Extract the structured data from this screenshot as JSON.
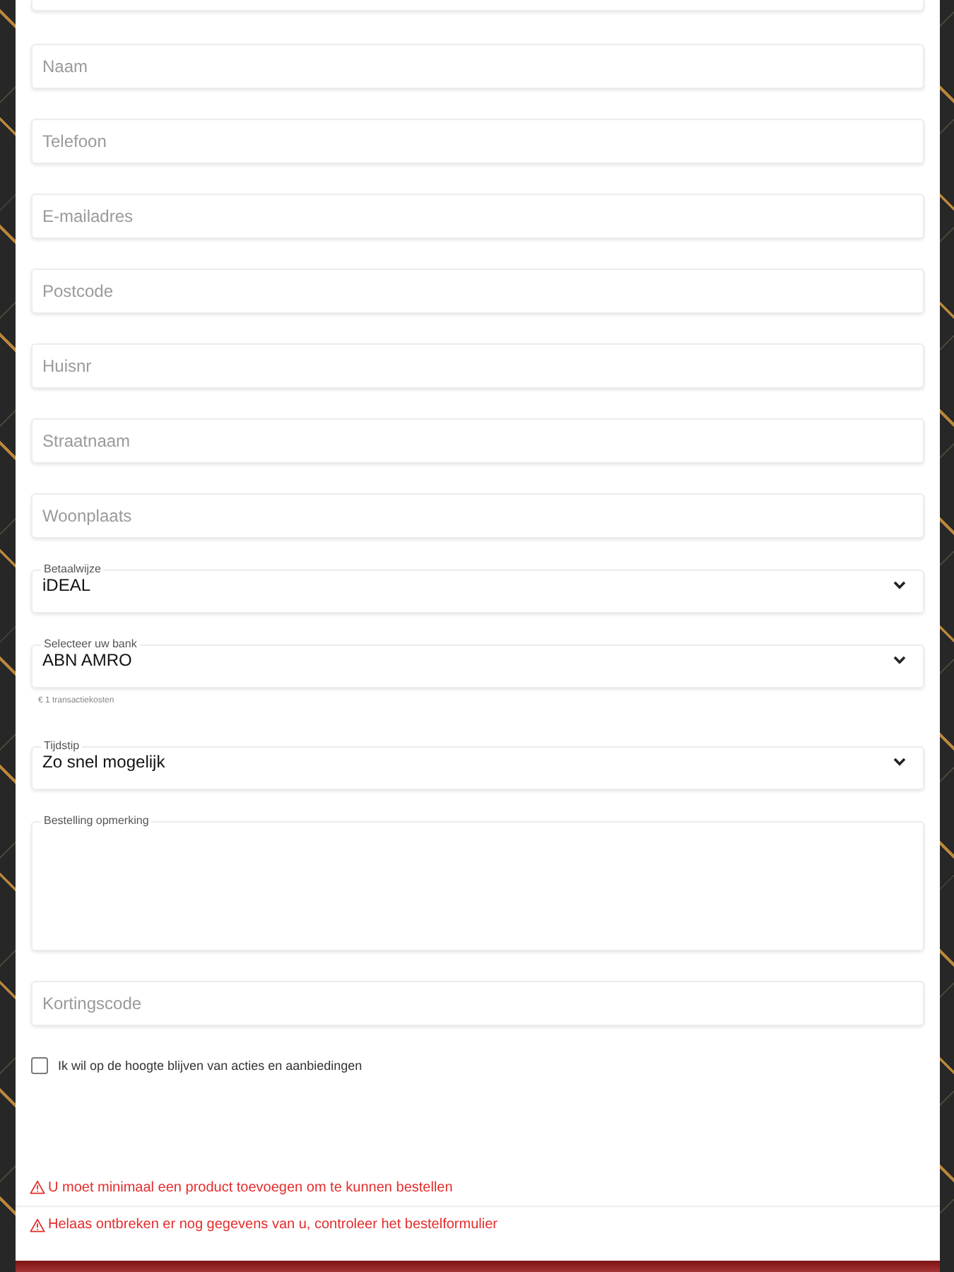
{
  "form": {
    "fields": [
      {
        "kind": "cut"
      },
      {
        "kind": "text",
        "placeholder": "Naam"
      },
      {
        "kind": "text",
        "placeholder": "Telefoon"
      },
      {
        "kind": "text",
        "placeholder": "E-mailadres"
      },
      {
        "kind": "text",
        "placeholder": "Postcode"
      },
      {
        "kind": "text",
        "placeholder": "Huisnr"
      },
      {
        "kind": "text",
        "placeholder": "Straatnaam"
      },
      {
        "kind": "text",
        "placeholder": "Woonplaats"
      },
      {
        "kind": "select",
        "label": "Betaalwijze",
        "value": "iDEAL"
      },
      {
        "kind": "select",
        "label": "Selecteer uw bank",
        "value": "ABN AMRO",
        "helper": "€ 1 transactiekosten"
      },
      {
        "kind": "select",
        "label": "Tijdstip",
        "value": "Zo snel mogelijk"
      },
      {
        "kind": "textarea",
        "label": "Bestelling opmerking"
      },
      {
        "kind": "text",
        "placeholder": "Kortingscode"
      }
    ],
    "newsletter": {
      "label": "Ik wil op de hoogte blijven van acties en aanbiedingen",
      "checked": false
    }
  },
  "errors": [
    "U moet minimaal een product toevoegen om te kunnen bestellen",
    "Helaas ontbreken er nog gegevens van u, controleer het bestelformulier"
  ]
}
